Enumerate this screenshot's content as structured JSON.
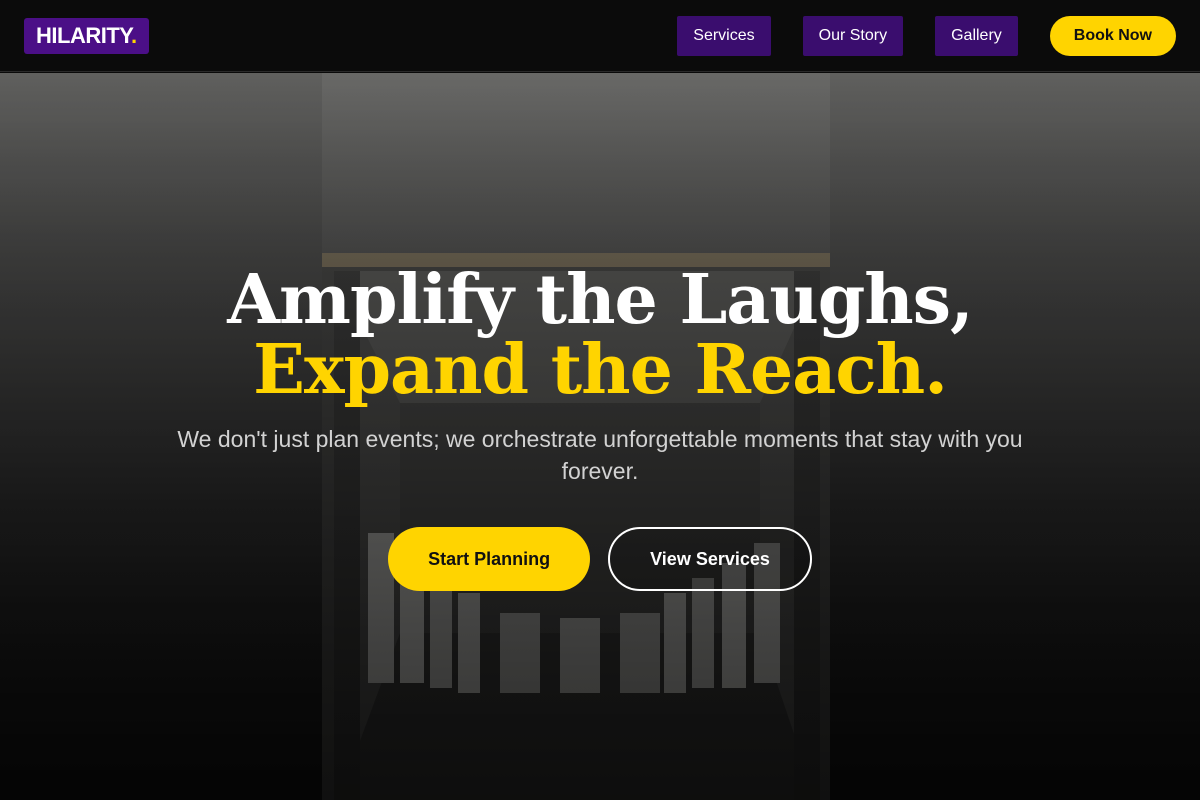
{
  "header": {
    "logo_text": "HILARITY",
    "logo_dot": ".",
    "nav": [
      {
        "label": "Services"
      },
      {
        "label": "Our Story"
      },
      {
        "label": "Gallery"
      }
    ],
    "cta_label": "Book Now"
  },
  "hero": {
    "headline_line1": "Amplify the Laughs,",
    "headline_line2": "Expand the Reach.",
    "subtitle": "We don't just plan events; we orchestrate unforgettable moments that stay with you forever.",
    "primary_button": "Start Planning",
    "secondary_button": "View Services"
  },
  "colors": {
    "brand_purple": "#4b0f87",
    "nav_purple": "#3a0d6e",
    "accent_yellow": "#ffd400",
    "background": "#0b0b0b"
  }
}
